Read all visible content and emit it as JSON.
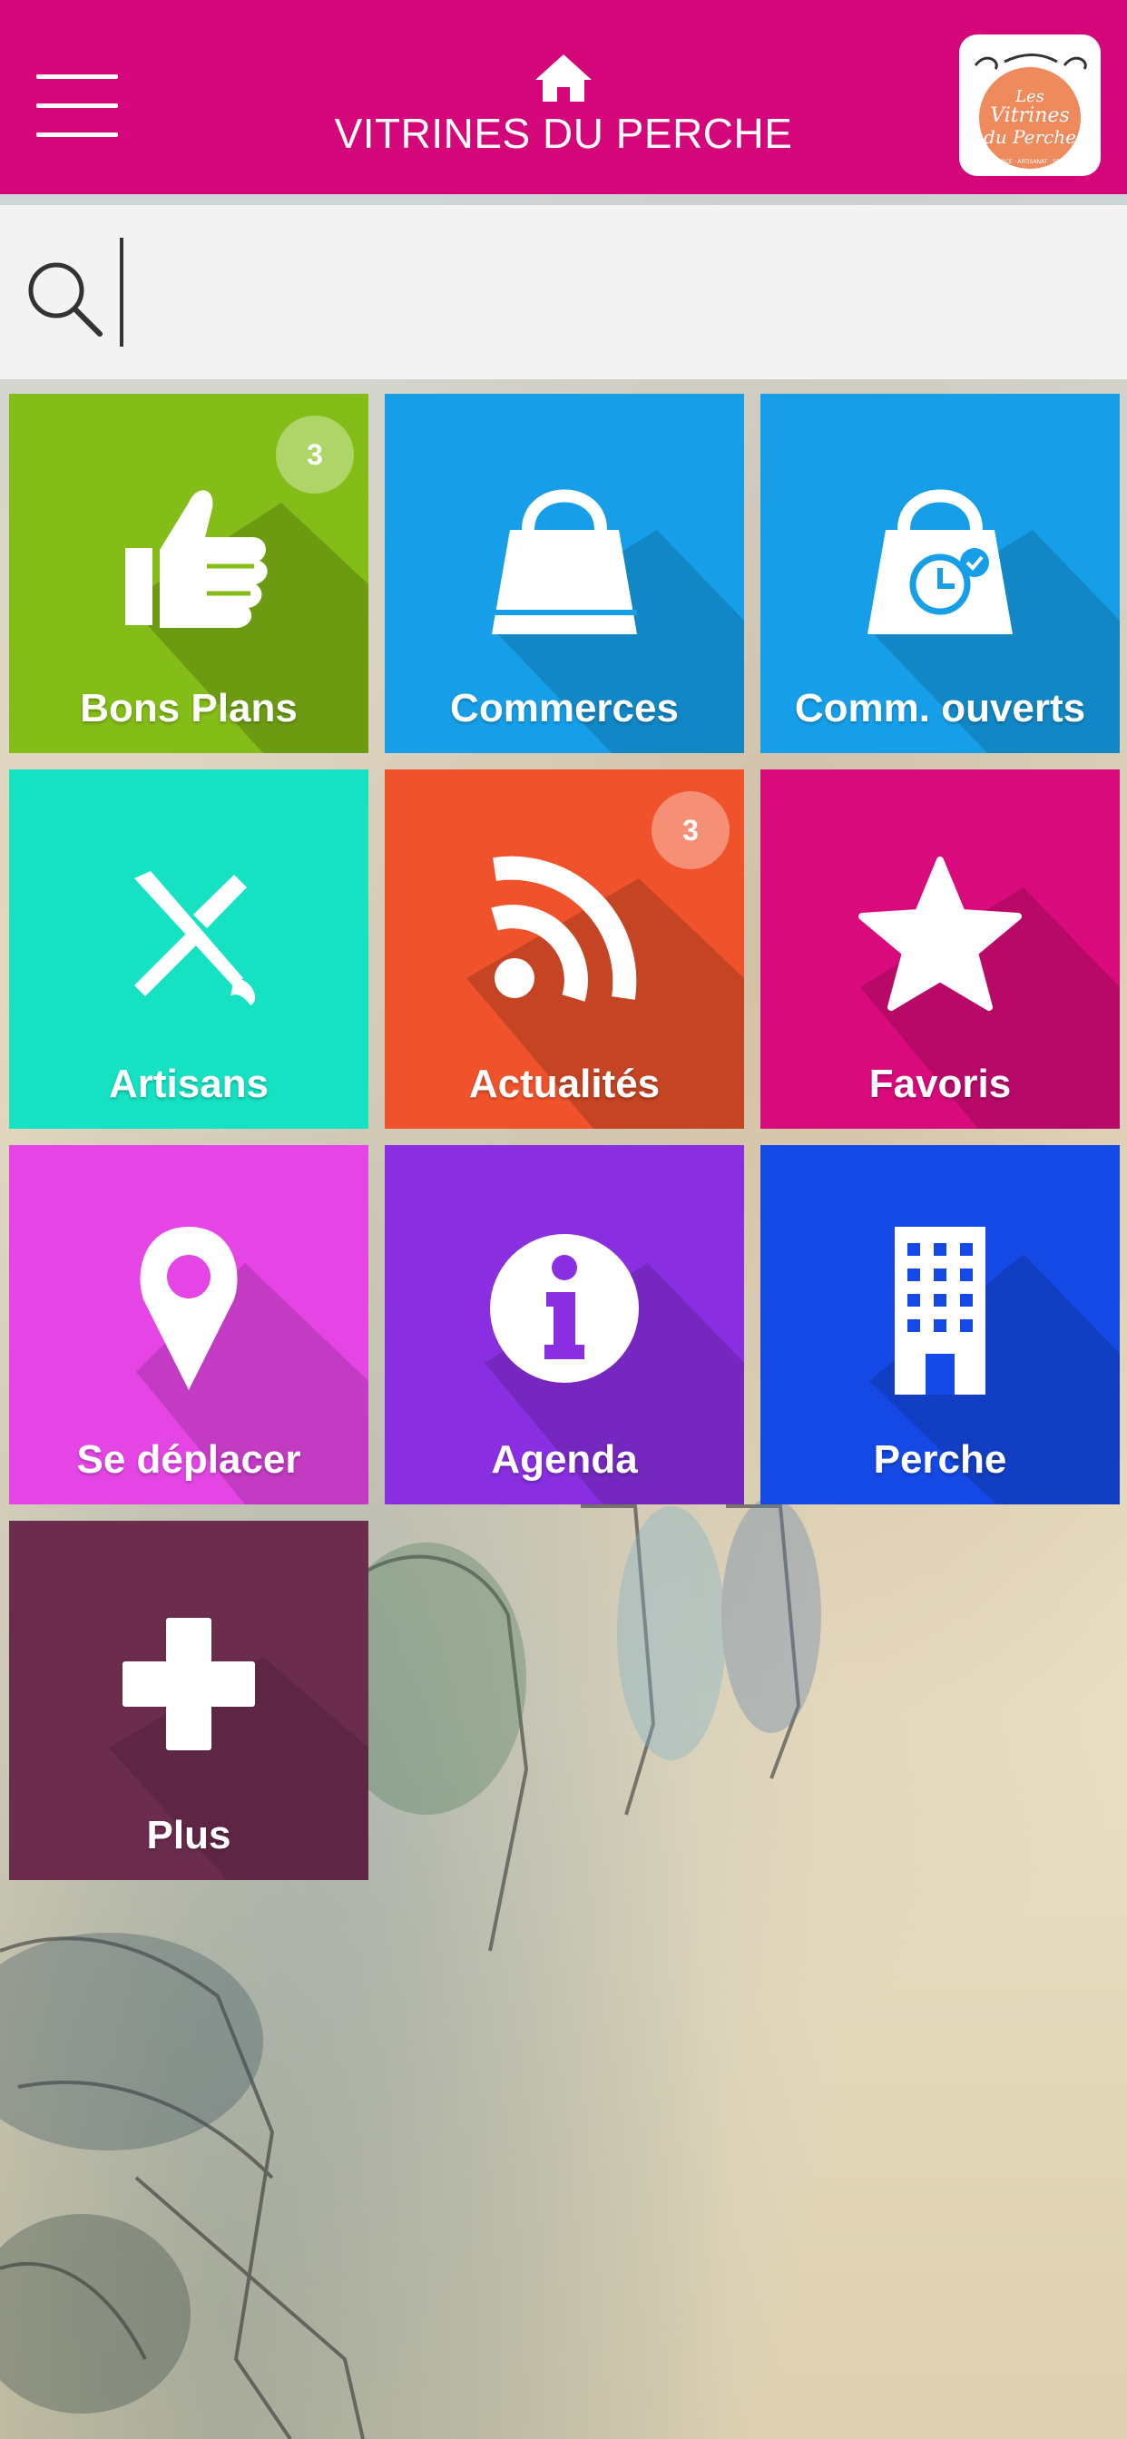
{
  "app": {
    "title": "VITRINES DU PERCHE"
  },
  "header": {
    "menu_icon": "hamburger-menu-icon",
    "home_icon": "home-icon",
    "logo_text": [
      "Les",
      "Vitrines",
      "du Perche"
    ],
    "logo_subtext": "COMMERCE · ARTISANAT · SERVICES"
  },
  "search": {
    "value": "",
    "icon": "search-icon"
  },
  "tiles": [
    {
      "label": "Bons Plans",
      "color": "#84bd17",
      "icon": "thumbs-up-icon",
      "badge": "3"
    },
    {
      "label": "Commerces",
      "color": "#169fe8",
      "icon": "shopping-bag-icon",
      "badge": ""
    },
    {
      "label": "Comm. ouverts",
      "color": "#169fe8",
      "icon": "shopping-bag-clock-icon",
      "badge": ""
    },
    {
      "label": "Artisans",
      "color": "#14e2c3",
      "icon": "tools-icon",
      "badge": ""
    },
    {
      "label": "Actualités",
      "color": "#f0532c",
      "icon": "rss-feed-icon",
      "badge": "3"
    },
    {
      "label": "Favoris",
      "color": "#d90b7c",
      "icon": "star-icon",
      "badge": ""
    },
    {
      "label": "Se déplacer",
      "color": "#e545e5",
      "icon": "map-pin-icon",
      "badge": ""
    },
    {
      "label": "Agenda",
      "color": "#8a2ee2",
      "icon": "info-icon",
      "badge": ""
    },
    {
      "label": "Perche",
      "color": "#1449e6",
      "icon": "building-icon",
      "badge": ""
    },
    {
      "label": "Plus",
      "color": "#6b2c4e",
      "icon": "plus-icon",
      "badge": ""
    }
  ]
}
